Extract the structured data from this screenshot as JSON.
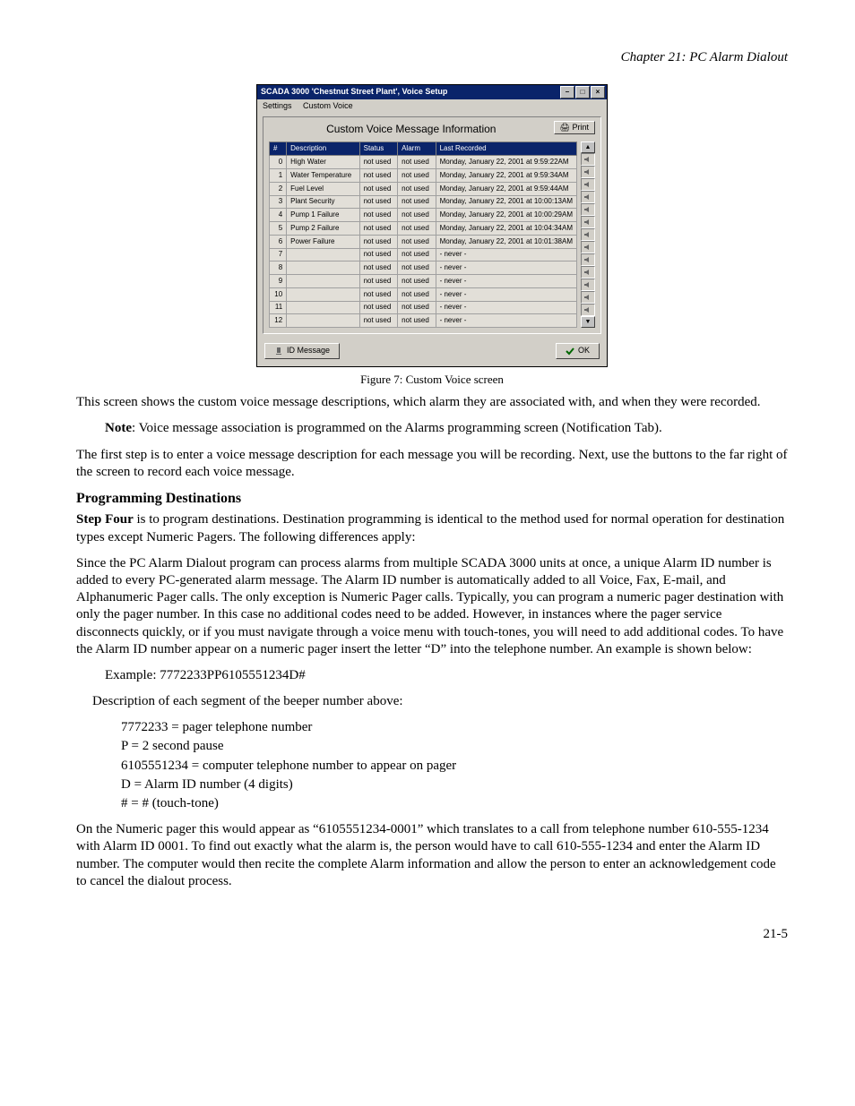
{
  "header": {
    "chapter": "Chapter 21: PC Alarm Dialout"
  },
  "figure": {
    "window_title": "SCADA 3000  'Chestnut Street Plant', Voice Setup",
    "menu": {
      "settings": "Settings",
      "custom_voice": "Custom Voice"
    },
    "panel_title": "Custom Voice Message Information",
    "print": "Print",
    "columns": {
      "idx": "#",
      "desc": "Description",
      "status": "Status",
      "alarm": "Alarm",
      "recorded": "Last Recorded"
    },
    "rows": [
      {
        "idx": "0",
        "desc": "High Water",
        "status": "not used",
        "alarm": "not used",
        "recorded": "Monday, January 22, 2001 at 9:59:22AM"
      },
      {
        "idx": "1",
        "desc": "Water Temperature",
        "status": "not used",
        "alarm": "not used",
        "recorded": "Monday, January 22, 2001 at 9:59:34AM"
      },
      {
        "idx": "2",
        "desc": "Fuel Level",
        "status": "not used",
        "alarm": "not used",
        "recorded": "Monday, January 22, 2001 at 9:59:44AM"
      },
      {
        "idx": "3",
        "desc": "Plant Security",
        "status": "not used",
        "alarm": "not used",
        "recorded": "Monday, January 22, 2001 at 10:00:13AM"
      },
      {
        "idx": "4",
        "desc": "Pump 1 Failure",
        "status": "not used",
        "alarm": "not used",
        "recorded": "Monday, January 22, 2001 at 10:00:29AM"
      },
      {
        "idx": "5",
        "desc": "Pump 2 Failure",
        "status": "not used",
        "alarm": "not used",
        "recorded": "Monday, January 22, 2001 at 10:04:34AM"
      },
      {
        "idx": "6",
        "desc": "Power Failure",
        "status": "not used",
        "alarm": "not used",
        "recorded": "Monday, January 22, 2001 at 10:01:38AM"
      },
      {
        "idx": "7",
        "desc": "",
        "status": "not used",
        "alarm": "not used",
        "recorded": "- never -"
      },
      {
        "idx": "8",
        "desc": "",
        "status": "not used",
        "alarm": "not used",
        "recorded": "- never -"
      },
      {
        "idx": "9",
        "desc": "",
        "status": "not used",
        "alarm": "not used",
        "recorded": "- never -"
      },
      {
        "idx": "10",
        "desc": "",
        "status": "not used",
        "alarm": "not used",
        "recorded": "- never -"
      },
      {
        "idx": "11",
        "desc": "",
        "status": "not used",
        "alarm": "not used",
        "recorded": "- never -"
      },
      {
        "idx": "12",
        "desc": "",
        "status": "not used",
        "alarm": "not used",
        "recorded": "- never -"
      }
    ],
    "btn_id_message": "ID Message",
    "btn_ok": "OK"
  },
  "caption": "Figure 7: Custom Voice screen",
  "body": {
    "p1": "This screen shows the custom voice message descriptions, which alarm they are associated with, and when they were recorded.",
    "note_label": "Note",
    "note_text": ": Voice message association is programmed on the Alarms programming screen (Notification Tab).",
    "p3": "The first step is to enter a voice message description for each message you will be recording. Next, use the buttons to the far right of the screen to record each voice message.",
    "h_dest": "Programming Destinations",
    "p4_strong": "Step Four",
    "p4_rest": " is to program destinations. Destination programming is identical to the method used for normal operation for destination types except Numeric Pagers. The following differences apply:",
    "p5": "Since the PC Alarm Dialout program can process alarms from multiple SCADA 3000 units at once, a unique Alarm ID number is added to every PC-generated alarm message.  The Alarm ID number is automatically added to all Voice, Fax, E-mail, and Alphanumeric Pager calls.  The only exception is Numeric Pager calls. Typically, you can program a numeric pager destination with only the pager number. In this case no additional codes need to be added. However, in instances where the pager service disconnects quickly, or if you must navigate through a voice menu with touch-tones, you will need to add additional codes. To have the Alarm ID number appear on a numeric pager insert the letter “D”  into the telephone number. An example is shown below:",
    "example": "Example:  7772233PP6105551234D#",
    "desc_intro": "Description of each segment of the beeper number above:",
    "seg1": "7772233 = pager telephone number",
    "seg2": "P = 2 second pause",
    "seg3": "6105551234 = computer telephone number to appear on pager",
    "seg4": "D = Alarm ID number (4 digits)",
    "seg5": "# = #  (touch-tone)",
    "p6": "On the Numeric pager this would appear as “6105551234-0001” which translates to a call from telephone number 610-555-1234 with Alarm ID 0001. To find out exactly what the alarm is, the person would have to call 610-555-1234 and enter the Alarm ID number. The computer would then recite the complete Alarm information and allow the person to enter an acknowledgement code to cancel the dialout process."
  },
  "footer": {
    "page": "21-5"
  }
}
